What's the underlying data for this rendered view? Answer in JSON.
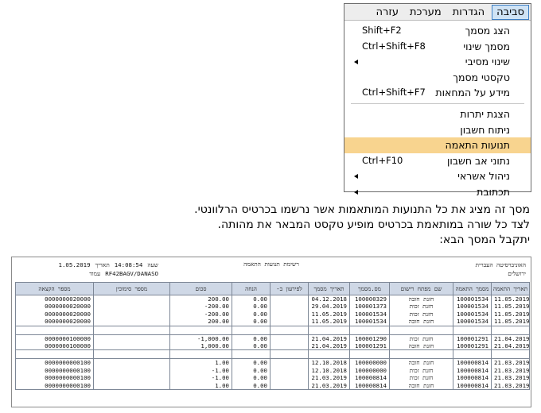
{
  "menu": {
    "bar": [
      "סביבה",
      "הגדרות",
      "מערכת",
      "עזרה"
    ],
    "items": [
      {
        "label": "הצג מסמך",
        "shortcut": "Shift+F2",
        "submenu": false,
        "highlight": false
      },
      {
        "label": "מסמך שינוי",
        "shortcut": "Ctrl+Shift+F8",
        "submenu": false,
        "highlight": false
      },
      {
        "label": "שינוי מסיבי",
        "shortcut": "",
        "submenu": true,
        "highlight": false
      },
      {
        "label": "טקסטי מסמך",
        "shortcut": "",
        "submenu": false,
        "highlight": false
      },
      {
        "label": "מידע על המחאות",
        "shortcut": "Ctrl+Shift+F7",
        "submenu": false,
        "highlight": false
      },
      {
        "sep": true
      },
      {
        "label": "הצגת יתרות",
        "shortcut": "",
        "submenu": false,
        "highlight": false
      },
      {
        "label": "ניתוח חשבון",
        "shortcut": "",
        "submenu": false,
        "highlight": false
      },
      {
        "label": "תנועות התאמה",
        "shortcut": "",
        "submenu": false,
        "highlight": true
      },
      {
        "label": "נתוני אב חשבון",
        "shortcut": "Ctrl+F10",
        "submenu": false,
        "highlight": false
      },
      {
        "label": "ניהול אשראי",
        "shortcut": "",
        "submenu": true,
        "highlight": false
      },
      {
        "label": "תכתובת",
        "shortcut": "",
        "submenu": true,
        "highlight": false
      }
    ]
  },
  "description": [
    "מסך זה מציג את כל התנועות המותאמות אשר נרשמו בכרטיס הרלוונטי.",
    "לצד כל שורה במותאמת בכרטיס מופיע טקסט המבאר את מהותה.",
    "יתקבל המסך הבא:"
  ],
  "report": {
    "company": "האוניברסיטה העברית",
    "city": "ירושלים",
    "title": "רשימת תנועות התאמה",
    "time_label": "שעה",
    "time": "14:08:54",
    "date_label": "תאריך",
    "date": "1.05.2019",
    "program": "RF42BAGV/DANASO",
    "page_label": "עמוד",
    "columns": [
      "תאריך התאמה",
      "מסמך התאמה",
      "שם מפתח רישום",
      "מס.מסמך",
      "תאריך מסמך",
      "לפירעון ב-",
      "הנחה",
      "סכום",
      "מספר סימוכין",
      "מספר הקצאה"
    ],
    "groups": [
      [
        [
          "11.05.2019",
          "100001534",
          "חזנת חובה",
          "100000329",
          "04.12.2018",
          "",
          "0.00",
          "200.00",
          "",
          "0000000020000"
        ],
        [
          "11.05.2019",
          "100001534",
          "חזנת זכות",
          "100001373",
          "29.04.2019",
          "",
          "0.00",
          "-200.00",
          "",
          "0000000020000"
        ],
        [
          "11.05.2019",
          "100001534",
          "חזנת זכות",
          "100001534",
          "11.05.2019",
          "",
          "0.00",
          "-200.00",
          "",
          "0000000020000"
        ],
        [
          "11.05.2019",
          "100001534",
          "חזנת חובה",
          "100001534",
          "11.05.2019",
          "",
          "0.00",
          "200.00",
          "",
          "0000000020000"
        ]
      ],
      [
        [
          "21.04.2019",
          "100001291",
          "חזנת זכות",
          "100001290",
          "21.04.2019",
          "",
          "0.00",
          "-1,000.00",
          "",
          "0000000100000"
        ],
        [
          "21.04.2019",
          "100001291",
          "חזנת חובה",
          "100001291",
          "21.04.2019",
          "",
          "0.00",
          "1,000.00",
          "",
          "0000000100000"
        ]
      ],
      [
        [
          "21.03.2019",
          "100000814",
          "חזנת חובה",
          "100000000",
          "12.10.2018",
          "",
          "0.00",
          "1.00",
          "",
          "0000000000100"
        ],
        [
          "21.03.2019",
          "100000814",
          "חזנת זכות",
          "100000000",
          "12.10.2018",
          "",
          "0.00",
          "-1.00",
          "",
          "0000000000100"
        ],
        [
          "21.03.2019",
          "100000814",
          "חזנת זכות",
          "100000814",
          "21.03.2019",
          "",
          "0.00",
          "-1.00",
          "",
          "0000000000100"
        ],
        [
          "21.03.2019",
          "100000814",
          "חזנת חובה",
          "100000814",
          "21.03.2019",
          "",
          "0.00",
          "1.00",
          "",
          "0000000000100"
        ]
      ]
    ]
  }
}
